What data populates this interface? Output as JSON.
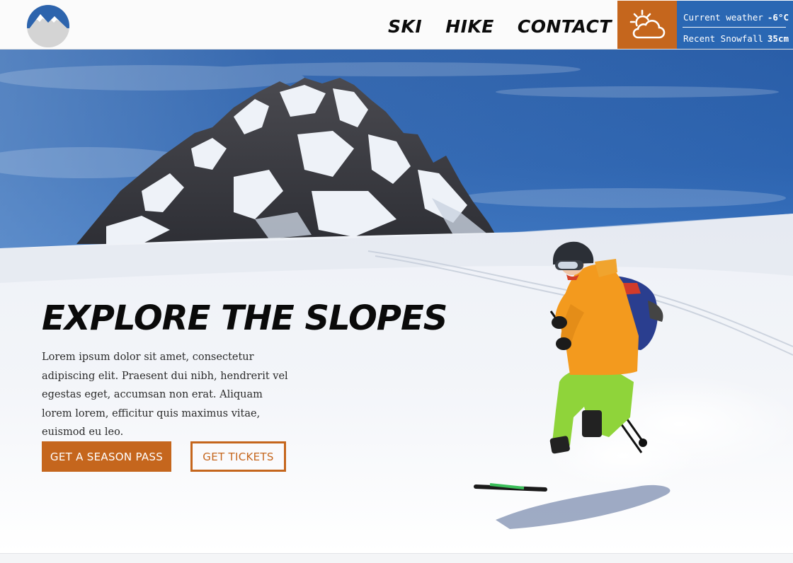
{
  "nav": {
    "logo_icon": "mountain-logo-icon",
    "items": [
      {
        "label": "SKI"
      },
      {
        "label": "HIKE"
      },
      {
        "label": "CONTACT"
      }
    ]
  },
  "weather": {
    "icon": "partly-sunny-cloud-icon",
    "current_label": "Current weather",
    "current_value": "-6°C",
    "snowfall_label": "Recent Snowfall",
    "snowfall_value": "35cm"
  },
  "hero": {
    "title": "EXPLORE THE SLOPES",
    "text": "Lorem ipsum dolor sit amet, consectetur adipiscing elit. Praesent dui nibh, hendrerit vel egestas eget, accumsan non erat. Aliquam lorem lorem, efficitur quis maximus vitae, euismod eu leo.",
    "primary_button": "GET A SEASON PASS",
    "secondary_button": "GET TICKETS",
    "image": "mountain-skier-photo"
  },
  "colors": {
    "accent_orange": "#c5661d",
    "accent_blue": "#2a67b3",
    "text_dark": "#0a0a0a"
  }
}
